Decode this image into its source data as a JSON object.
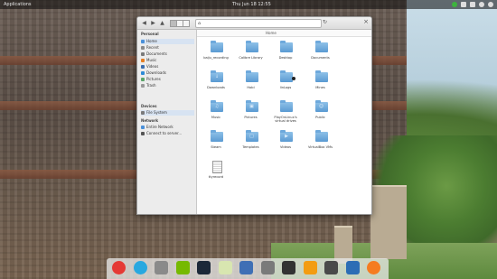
{
  "panel": {
    "applications_label": "Applications",
    "clock_label": "Thu Jun 18   12:55"
  },
  "window": {
    "breadcrumb": "Home"
  },
  "sidebar": {
    "personal_header": "Personal",
    "personal_items": [
      {
        "label": "Home",
        "icon": "home-icon",
        "active": true
      },
      {
        "label": "Recent",
        "icon": "recent-icon",
        "active": false
      },
      {
        "label": "Documents",
        "icon": "documents-icon",
        "active": false
      },
      {
        "label": "Music",
        "icon": "music-icon",
        "active": false
      },
      {
        "label": "Videos",
        "icon": "videos-icon",
        "active": false
      },
      {
        "label": "Downloads",
        "icon": "downloads-icon",
        "active": false
      },
      {
        "label": "Pictures",
        "icon": "pictures-icon",
        "active": false
      },
      {
        "label": "Trash",
        "icon": "trash-icon",
        "active": false
      }
    ],
    "devices_header": "Devices",
    "devices_items": [
      {
        "label": "File System",
        "icon": "drive-icon",
        "active": true
      }
    ],
    "network_header": "Network",
    "network_items": [
      {
        "label": "Entire Network",
        "icon": "network-icon",
        "active": false
      },
      {
        "label": "Connect to server...",
        "icon": "server-icon",
        "active": false
      }
    ]
  },
  "files": [
    {
      "name": "baiju_recording",
      "type": "folder"
    },
    {
      "name": "Calibre Library",
      "type": "folder"
    },
    {
      "name": "Desktop",
      "type": "folder"
    },
    {
      "name": "Documents",
      "type": "folder"
    },
    {
      "name": "Downloads",
      "type": "folder"
    },
    {
      "name": "Hobi",
      "type": "folder"
    },
    {
      "name": "linLogs",
      "type": "folder"
    },
    {
      "name": "Mines",
      "type": "folder"
    },
    {
      "name": "Music",
      "type": "folder"
    },
    {
      "name": "Pictures",
      "type": "folder"
    },
    {
      "name": "PlayOnLinux's virtual drives",
      "type": "folder"
    },
    {
      "name": "Public",
      "type": "folder"
    },
    {
      "name": "Steam",
      "type": "folder"
    },
    {
      "name": "Templates",
      "type": "folder"
    },
    {
      "name": "Videos",
      "type": "folder"
    },
    {
      "name": "VirtualBox VMs",
      "type": "folder"
    },
    {
      "name": "ttyrecord",
      "type": "file"
    }
  ],
  "dock_apps": [
    {
      "name": "chrome-icon",
      "color": "#e53935"
    },
    {
      "name": "skype-icon",
      "color": "#29a8e0"
    },
    {
      "name": "files-icon",
      "color": "#8a8a8a"
    },
    {
      "name": "nvidia-icon",
      "color": "#76b900"
    },
    {
      "name": "steam-icon",
      "color": "#1b2838"
    },
    {
      "name": "notes-icon",
      "color": "#d8e6b0"
    },
    {
      "name": "document-viewer-icon",
      "color": "#3f6fb5"
    },
    {
      "name": "photos-icon",
      "color": "#7a7a7a"
    },
    {
      "name": "terminal-icon",
      "color": "#333333"
    },
    {
      "name": "vlc-icon",
      "color": "#f39c12"
    },
    {
      "name": "system-monitor-icon",
      "color": "#4a4a4a"
    },
    {
      "name": "virtualbox-icon",
      "color": "#2d6db5"
    },
    {
      "name": "update-icon",
      "color": "#f57c20"
    }
  ]
}
